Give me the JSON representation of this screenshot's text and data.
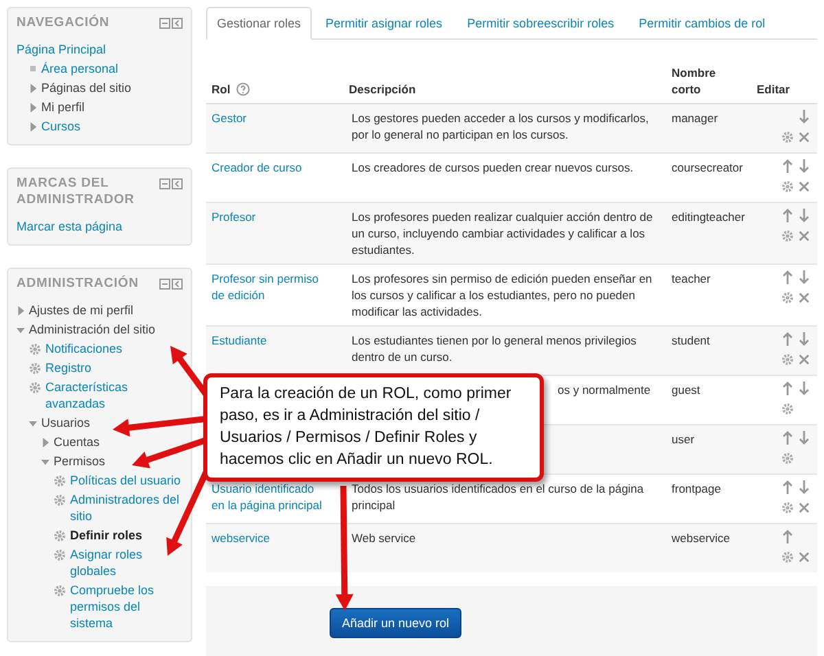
{
  "sidebar": {
    "blocks": [
      {
        "title": "NAVEGACIÓN",
        "items": [
          {
            "label": "Página Principal",
            "kind": "plain",
            "link": true,
            "current": false,
            "children": [
              {
                "label": "Área personal",
                "kind": "leaf",
                "link": true,
                "current": false
              },
              {
                "label": "Páginas del sitio",
                "kind": "branch",
                "expanded": false,
                "link": false,
                "current": false
              },
              {
                "label": "Mi perfil",
                "kind": "branch",
                "expanded": false,
                "link": false,
                "current": false
              },
              {
                "label": "Cursos",
                "kind": "branch",
                "expanded": false,
                "link": true,
                "current": false
              }
            ]
          }
        ]
      },
      {
        "title": "MARCAS DEL ADMINISTRADOR",
        "items": [
          {
            "label": "Marcar esta página",
            "kind": "plain",
            "link": true,
            "current": false
          }
        ]
      },
      {
        "title": "ADMINISTRACIÓN",
        "items": [
          {
            "label": "Ajustes de mi perfil",
            "kind": "branch",
            "expanded": false,
            "link": false,
            "current": false
          },
          {
            "label": "Administración del sitio",
            "kind": "branch",
            "expanded": true,
            "link": false,
            "current": false,
            "children": [
              {
                "label": "Notificaciones",
                "kind": "setting",
                "link": true,
                "current": false
              },
              {
                "label": "Registro",
                "kind": "setting",
                "link": true,
                "current": false
              },
              {
                "label": "Características avanzadas",
                "kind": "setting",
                "link": true,
                "current": false
              },
              {
                "label": "Usuarios",
                "kind": "branch",
                "expanded": true,
                "link": false,
                "current": false,
                "children": [
                  {
                    "label": "Cuentas",
                    "kind": "branch",
                    "expanded": false,
                    "link": false,
                    "current": false
                  },
                  {
                    "label": "Permisos",
                    "kind": "branch",
                    "expanded": true,
                    "link": false,
                    "current": false,
                    "children": [
                      {
                        "label": "Políticas del usuario",
                        "kind": "setting",
                        "link": true,
                        "current": false
                      },
                      {
                        "label": "Administradores del sitio",
                        "kind": "setting",
                        "link": true,
                        "current": false
                      },
                      {
                        "label": "Definir roles",
                        "kind": "setting",
                        "link": true,
                        "current": true
                      },
                      {
                        "label": "Asignar roles globales",
                        "kind": "setting",
                        "link": true,
                        "current": false
                      },
                      {
                        "label": "Compruebe los permisos del sistema",
                        "kind": "setting",
                        "link": true,
                        "current": false
                      }
                    ]
                  }
                ]
              }
            ]
          }
        ]
      }
    ]
  },
  "tabs": [
    {
      "label": "Gestionar roles",
      "selected": true
    },
    {
      "label": "Permitir asignar roles",
      "selected": false
    },
    {
      "label": "Permitir sobreescribir roles",
      "selected": false
    },
    {
      "label": "Permitir cambios de rol",
      "selected": false
    }
  ],
  "table": {
    "columns": [
      "Rol",
      "Descripción",
      "Nombre corto",
      "Editar"
    ],
    "rows": [
      {
        "role": "Gestor",
        "description": "Los gestores pueden acceder a los cursos y modificarlos, por lo general no participan en los cursos.",
        "shortname": "manager",
        "up": false,
        "down": true,
        "delete": true
      },
      {
        "role": "Creador de curso",
        "description": "Los creadores de cursos pueden crear nuevos cursos.",
        "shortname": "coursecreator",
        "up": true,
        "down": true,
        "delete": true
      },
      {
        "role": "Profesor",
        "description": "Los profesores pueden realizar cualquier acción dentro de un curso, incluyendo cambiar actividades y calificar a los estudiantes.",
        "shortname": "editingteacher",
        "up": true,
        "down": true,
        "delete": true
      },
      {
        "role": "Profesor sin permiso de edición",
        "description": "Los profesores sin permiso de edición pueden enseñar en los cursos y calificar a los estudiantes, pero no pueden modificar las actividades.",
        "shortname": "teacher",
        "up": true,
        "down": true,
        "delete": true
      },
      {
        "role": "Estudiante",
        "description": "Los estudiantes tienen por lo general menos privilegios dentro de un curso.",
        "shortname": "student",
        "up": true,
        "down": true,
        "delete": true
      },
      {
        "description": "os y normalmente",
        "shortname": "guest",
        "up": true,
        "down": true,
        "delete": false
      },
      {
        "shortname": "user",
        "up": true,
        "down": true,
        "delete": false
      },
      {
        "role": "Usuario identificado en la página principal",
        "description": "Todos los usuarios identificados en el curso de la página principal",
        "shortname": "frontpage",
        "up": true,
        "down": true,
        "delete": true
      },
      {
        "role": "webservice",
        "description": "Web service",
        "shortname": "webservice",
        "up": true,
        "down": false,
        "delete": true
      }
    ]
  },
  "add_button": "Añadir un nuevo rol",
  "callout": {
    "text": "Para la creación de un ROL, como primer paso, es ir a Administración del sitio / Usuarios / Permisos / Definir Roles y hacemos clic en Añadir un nuevo ROL."
  }
}
